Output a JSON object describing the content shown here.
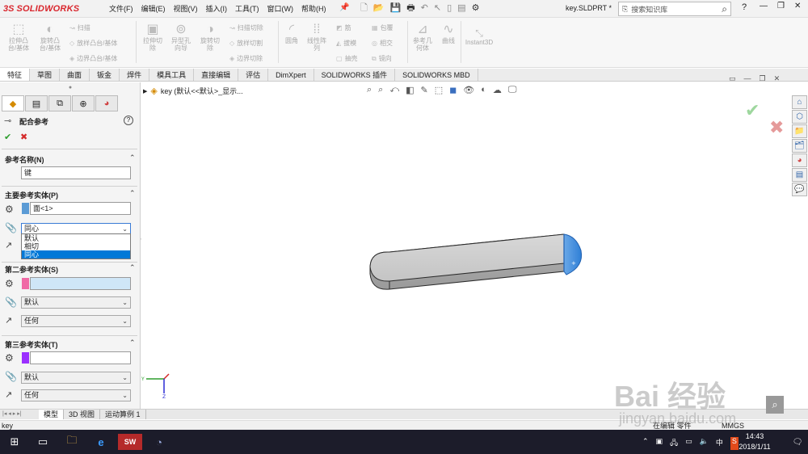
{
  "app": {
    "brand_prefix": "3S",
    "brand": "SOLIDWORKS",
    "menu": [
      "文件(F)",
      "编辑(E)",
      "视图(V)",
      "插入(I)",
      "工具(T)",
      "窗口(W)",
      "帮助(H)"
    ],
    "doc_name": "key.SLDPRT *",
    "search_placeholder": "搜索知识库",
    "help_label": "?"
  },
  "ribbon": {
    "extrude_boss": "拉伸凸\n台/基体",
    "revolve_boss": "旋转凸\n台/基体",
    "sweep": "扫描",
    "loft_boss": "放样凸台/基体",
    "boundary_boss": "边界凸台/基体",
    "extrude_cut": "拉伸切\n除",
    "hole_wizard": "异型孔\n向导",
    "revolve_cut": "旋转切\n除",
    "sweep_cut": "扫描切除",
    "loft_cut": "放样切割",
    "boundary_cut": "边界切除",
    "fillet": "圆角",
    "linear_pattern": "线性阵\n列",
    "rib": "筋",
    "draft": "拔模",
    "shell": "抽壳",
    "wrap": "包覆",
    "intersect": "相交",
    "mirror": "镜向",
    "ref_geometry": "参考几\n何体",
    "curves": "曲线",
    "instant3d": "Instant3D"
  },
  "tabs": [
    "特征",
    "草图",
    "曲面",
    "钣金",
    "焊件",
    "模具工具",
    "直接编辑",
    "评估",
    "DimXpert",
    "SOLIDWORKS 插件",
    "SOLIDWORKS MBD"
  ],
  "panel": {
    "title": "配合参考",
    "help": "?",
    "ref_name_label": "参考名称(N)",
    "ref_name_value": "键",
    "primary_label": "主要参考实体(P)",
    "primary_entity": "面<1>",
    "primary_mate_type": "同心",
    "mate_options": [
      "默认",
      "相切",
      "同心"
    ],
    "secondary_label": "第二参考实体(S)",
    "secondary_entity": "",
    "secondary_mate_type": "默认",
    "secondary_alignment": "任何",
    "tertiary_label": "第三参考实体(T)",
    "tertiary_entity": "",
    "tertiary_mate_type": "默认",
    "tertiary_alignment": "任何",
    "colors": {
      "primary": "#5b9bd5",
      "secondary": "#f06aa6",
      "tertiary": "#9b30ff"
    }
  },
  "viewport": {
    "tree_root": "key (默认<<默认>_显示..."
  },
  "bottom": {
    "tabs": [
      "模型",
      "3D 视图",
      "运动算例 1"
    ],
    "status_left": "key",
    "status_edit": "在编辑 零件",
    "status_units": "MMGS"
  },
  "taskbar": {
    "time": "14:43",
    "date": "2018/1/11",
    "ime": "中"
  },
  "watermark": {
    "text": "Bai 经验",
    "url": "jingyan.baidu.com"
  }
}
